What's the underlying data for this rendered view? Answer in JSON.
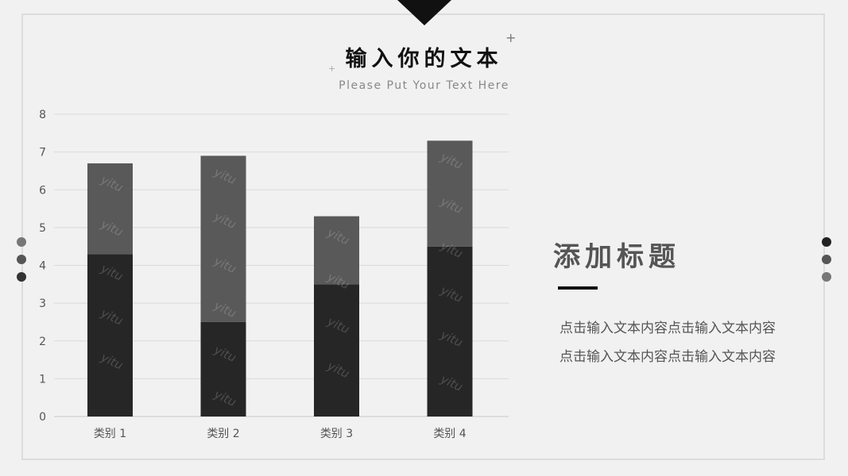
{
  "header": {
    "title": "输入你的文本",
    "subtitle": "Please Put Your Text Here"
  },
  "side_panel": {
    "title": "添加标题",
    "body": "点击输入文本内容点击输入文本内容点击输入文本内容点击输入文本内容"
  },
  "colors": {
    "series1": "#262626",
    "series2": "#595959",
    "background": "#f1f1f1"
  },
  "chart_data": {
    "type": "bar",
    "stacked": true,
    "categories": [
      "类别 1",
      "类别 2",
      "类别 3",
      "类别 4"
    ],
    "series": [
      {
        "values": [
          4.3,
          2.5,
          3.5,
          4.5
        ]
      },
      {
        "values": [
          2.4,
          4.4,
          1.8,
          2.8
        ]
      }
    ],
    "ylim": [
      0,
      8
    ],
    "yticks": [
      "0",
      "1",
      "2",
      "3",
      "4",
      "5",
      "6",
      "7",
      "8"
    ],
    "grid": true,
    "watermark": "yitu"
  }
}
